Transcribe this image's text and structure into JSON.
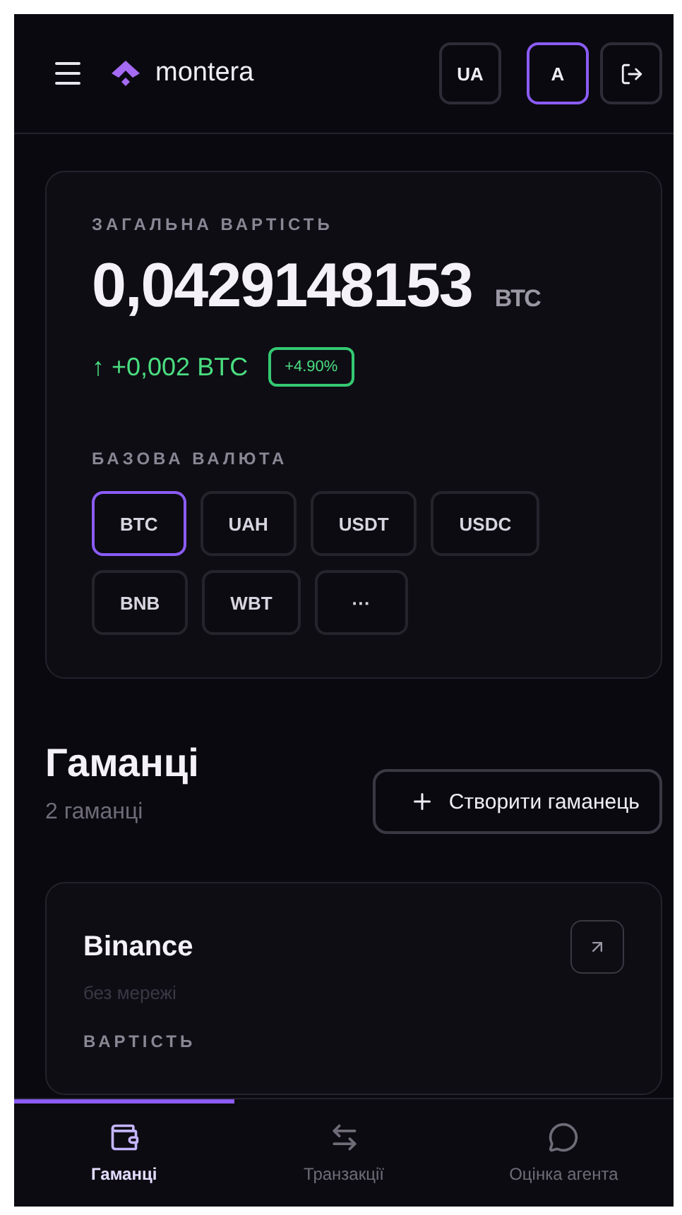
{
  "header": {
    "brand": "montera",
    "buttons": [
      {
        "label": "UA",
        "selected": false
      },
      {
        "label": "A",
        "selected": true
      }
    ]
  },
  "portfolio": {
    "label": "ЗАГАЛЬНА ВАРТІСТЬ",
    "value": "0,0429148153",
    "unit": "BTC",
    "change_arrow": "↑",
    "change": "+0,002 BTC",
    "change_percent": "+4.90%",
    "currency_label": "БАЗОВА ВАЛЮТА",
    "currencies": [
      {
        "label": "BTC",
        "selected": true
      },
      {
        "label": "UAH",
        "selected": false
      },
      {
        "label": "USDT",
        "selected": false
      },
      {
        "label": "USDC",
        "selected": false
      },
      {
        "label": "BNB",
        "selected": false
      },
      {
        "label": "WBT",
        "selected": false
      },
      {
        "label": "···",
        "selected": false
      }
    ]
  },
  "wallets_section": {
    "title": "Гаманці",
    "count": "2 гаманці",
    "create_button": "Створити гаманець"
  },
  "wallets": [
    {
      "name": "Binance",
      "network": "без мережі",
      "value_label": "ВАРТІСТЬ"
    }
  ],
  "nav": [
    {
      "label": "Гаманці",
      "selected": true
    },
    {
      "label": "Транзакції",
      "selected": false
    },
    {
      "label": "Оцінка агента",
      "selected": false
    }
  ]
}
